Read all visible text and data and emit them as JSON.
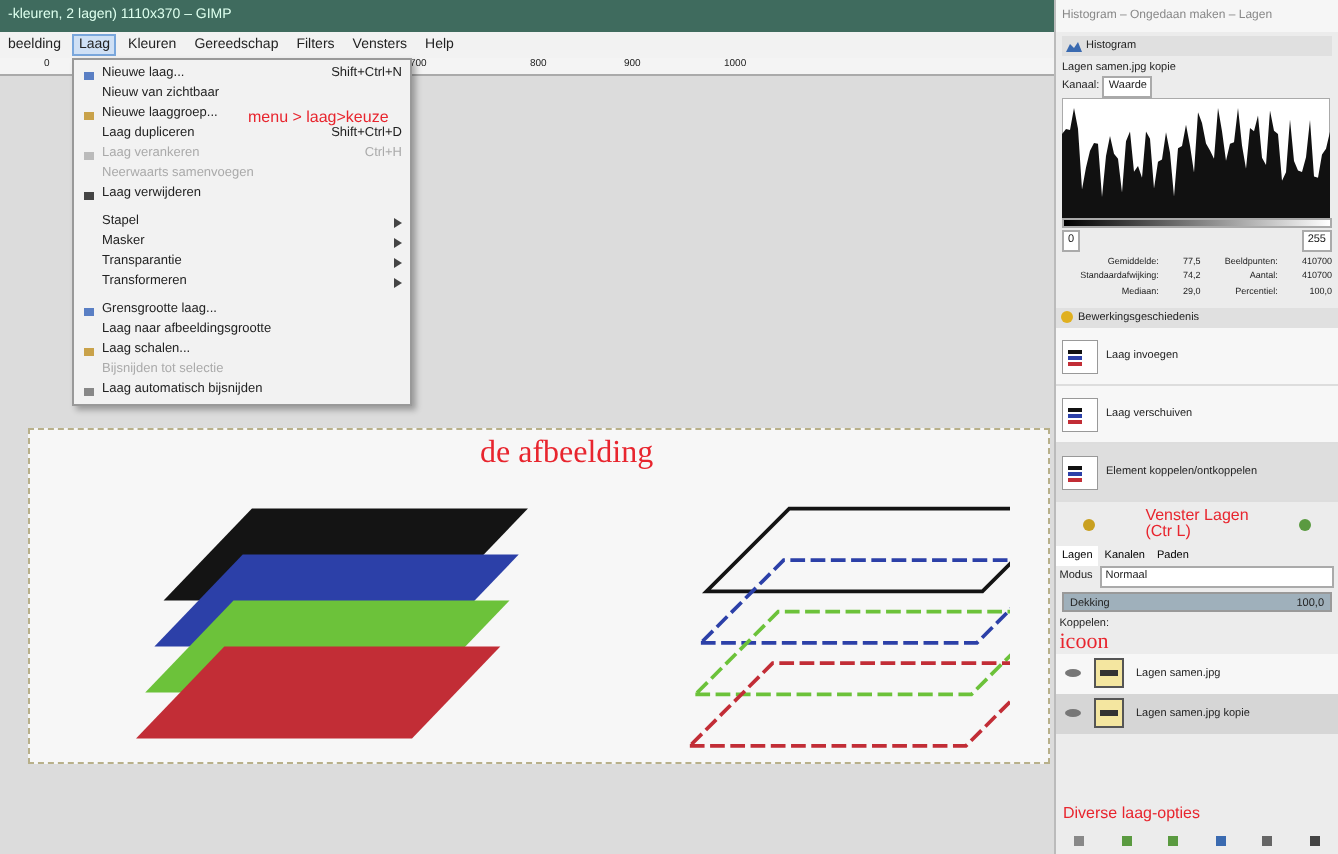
{
  "window": {
    "title": "-kleuren, 2 lagen) 1110x370 – GIMP"
  },
  "menubar": [
    {
      "label": "beelding",
      "selected": false
    },
    {
      "label": "Laag",
      "selected": true
    },
    {
      "label": "Kleuren",
      "selected": false
    },
    {
      "label": "Gereedschap",
      "selected": false
    },
    {
      "label": "Filters",
      "selected": false
    },
    {
      "label": "Vensters",
      "selected": false
    },
    {
      "label": "Help",
      "selected": false
    }
  ],
  "ruler": [
    "0",
    "700",
    "800",
    "900",
    "1000"
  ],
  "menu": {
    "groups": [
      [
        {
          "label": "Nieuwe laag...",
          "shortcut": "Shift+Ctrl+N",
          "disabled": false,
          "submenu": false
        },
        {
          "label": "Nieuw van zichtbaar",
          "disabled": false,
          "submenu": false
        },
        {
          "label": "Nieuwe laaggroep...",
          "disabled": false,
          "submenu": false
        },
        {
          "label": "Laag dupliceren",
          "shortcut": "Shift+Ctrl+D",
          "disabled": false,
          "submenu": false
        },
        {
          "label": "Laag verankeren",
          "shortcut": "Ctrl+H",
          "disabled": true,
          "submenu": false
        },
        {
          "label": "Neerwaarts samenvoegen",
          "disabled": true,
          "submenu": false
        },
        {
          "label": "Laag verwijderen",
          "disabled": false,
          "submenu": false
        }
      ],
      [
        {
          "label": "Stapel",
          "disabled": false,
          "submenu": true
        },
        {
          "label": "Masker",
          "disabled": false,
          "submenu": true
        },
        {
          "label": "Transparantie",
          "disabled": false,
          "submenu": true
        },
        {
          "label": "Transformeren",
          "disabled": false,
          "submenu": true
        }
      ],
      [
        {
          "label": "Grensgrootte laag...",
          "disabled": false,
          "submenu": false
        },
        {
          "label": "Laag naar afbeeldingsgrootte",
          "disabled": false,
          "submenu": false
        },
        {
          "label": "Laag schalen...",
          "disabled": false,
          "submenu": false
        },
        {
          "label": "Bijsnijden tot selectie",
          "disabled": true,
          "submenu": false
        },
        {
          "label": "Laag automatisch bijsnijden",
          "disabled": false,
          "submenu": false
        }
      ]
    ]
  },
  "annotations": {
    "menu": "menu > laag>keuze",
    "image": "de afbeelding",
    "layers_window": "Venster Lagen\n(Ctr L)",
    "icon": "icoon",
    "options": "Diverse laag-opties"
  },
  "dock": {
    "title": "Histogram – Ongedaan maken – Lagen",
    "histogram": {
      "tab": "Histogram",
      "layer": "Lagen samen.jpg kopie",
      "channel_label": "Kanaal:",
      "channel": "Waarde",
      "range_min": "0",
      "range_max": "255",
      "stats": [
        [
          "Gemiddelde:",
          "77,5",
          "Beeldpunten:",
          "410700"
        ],
        [
          "Standaardafwijking:",
          "74,2",
          "Aantal:",
          "410700"
        ],
        [
          "Mediaan:",
          "29,0",
          "Percentiel:",
          "100,0"
        ]
      ]
    },
    "undo": {
      "tab": "Bewerkingsgeschiedenis",
      "items": [
        {
          "label": "Laag invoegen",
          "selected": false
        },
        {
          "label": "Laag verschuiven",
          "selected": false
        },
        {
          "label": "Element koppelen/ontkoppelen",
          "selected": true
        }
      ]
    },
    "layers": {
      "tabs": [
        {
          "label": "Lagen",
          "selected": true
        },
        {
          "label": "Kanalen",
          "selected": false
        },
        {
          "label": "Paden",
          "selected": false
        }
      ],
      "mode_label": "Modus",
      "mode": "Normaal",
      "opacity_label": "Dekking",
      "opacity": "100,0",
      "level": 1,
      "lock_label": "Koppelen:",
      "items": [
        {
          "name": "Lagen samen.jpg",
          "selected": false
        },
        {
          "name": "Lagen samen.jpg kopie",
          "selected": true
        }
      ]
    }
  }
}
